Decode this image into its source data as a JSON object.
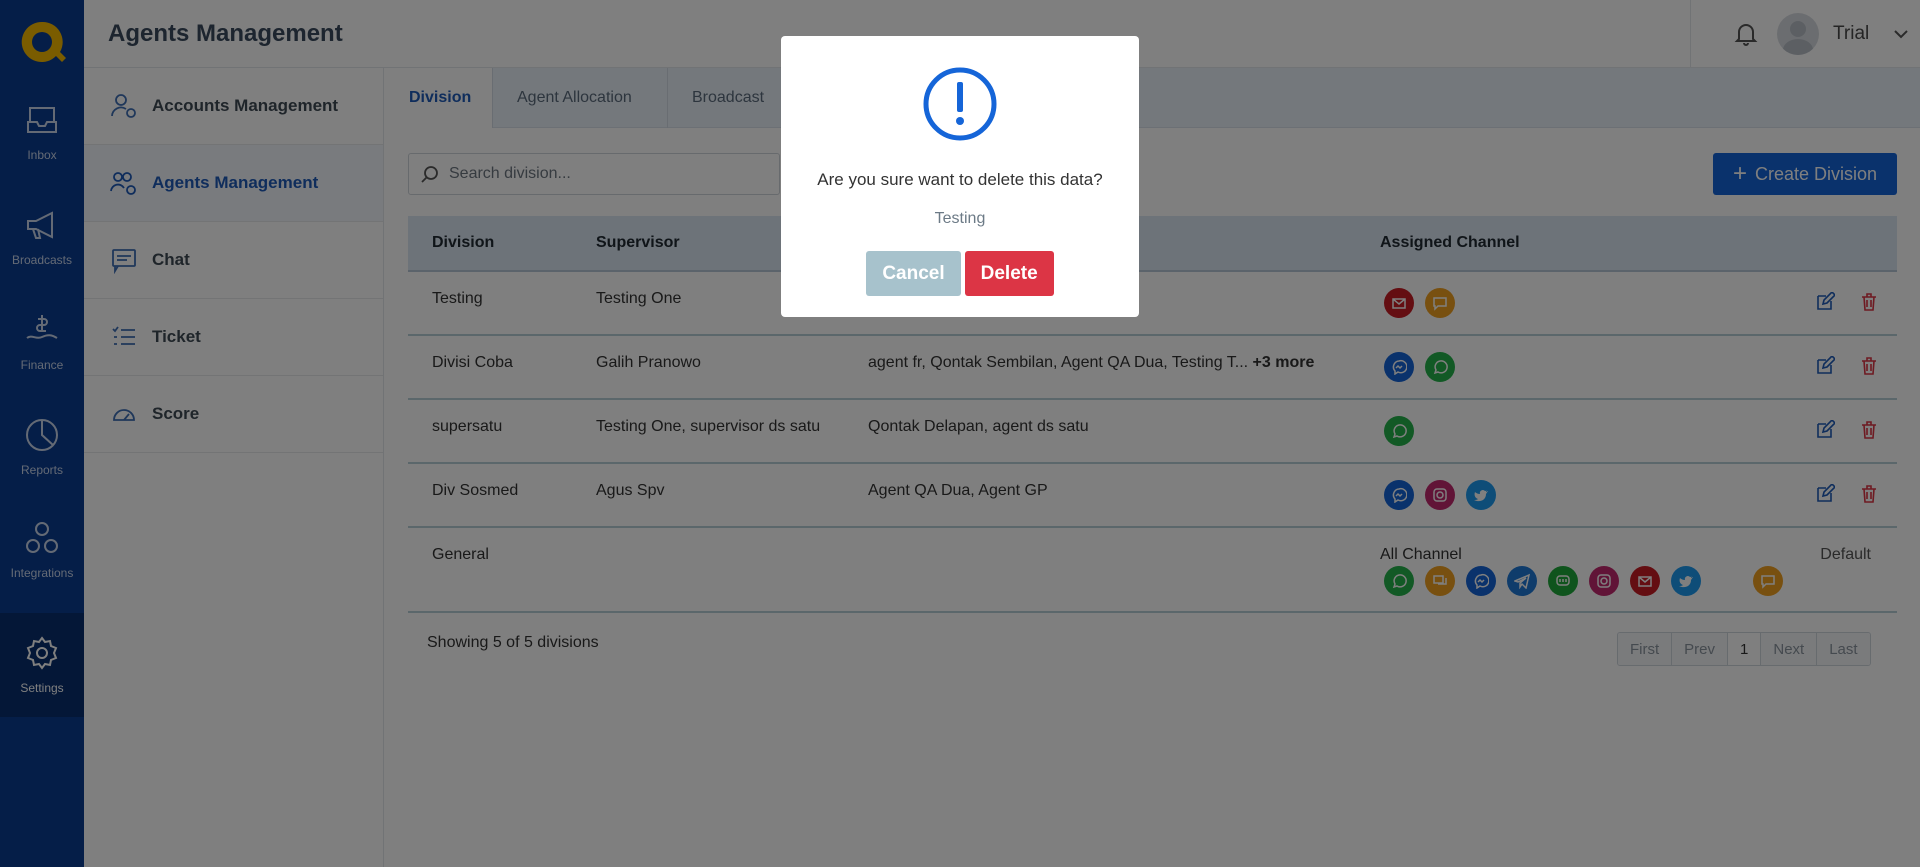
{
  "header": {
    "title": "Agents Management",
    "user_name": "Trial"
  },
  "rail": [
    {
      "label": "Inbox",
      "icon": "inbox-icon"
    },
    {
      "label": "Broadcasts",
      "icon": "megaphone-icon"
    },
    {
      "label": "Finance",
      "icon": "finance-icon"
    },
    {
      "label": "Reports",
      "icon": "pie-chart-icon"
    },
    {
      "label": "Integrations",
      "icon": "integrations-icon"
    },
    {
      "label": "Settings",
      "icon": "gear-icon"
    }
  ],
  "subnav": [
    {
      "label": "Accounts Management"
    },
    {
      "label": "Agents Management"
    },
    {
      "label": "Chat"
    },
    {
      "label": "Ticket"
    },
    {
      "label": "Score"
    }
  ],
  "tabs": [
    "Division",
    "Agent Allocation",
    "Broadcast"
  ],
  "search": {
    "placeholder": "Search division..."
  },
  "create_button": "Create Division",
  "table": {
    "headers": [
      "Division",
      "Supervisor",
      "",
      "Assigned Channel"
    ],
    "rows": [
      {
        "division": "Testing",
        "supervisor": "Testing One",
        "agents": "",
        "more": "",
        "channels": [
          "email",
          "chat"
        ]
      },
      {
        "division": "Divisi Coba",
        "supervisor": "Galih Pranowo",
        "agents": "agent fr, Qontak Sembilan, Agent QA Dua, Testing T...",
        "more": "+3 more",
        "channels": [
          "messenger",
          "whatsapp"
        ]
      },
      {
        "division": "supersatu",
        "supervisor": "Testing One, supervisor ds satu",
        "agents": "Qontak Delapan, agent ds satu",
        "more": "",
        "channels": [
          "whatsapp"
        ]
      },
      {
        "division": "Div Sosmed",
        "supervisor": "Agus Spv",
        "agents": "Agent QA Dua, Agent GP",
        "more": "",
        "channels": [
          "messenger",
          "instagram",
          "twitter"
        ]
      }
    ],
    "general": {
      "division": "General",
      "all_channel": "All Channel",
      "default": "Default"
    }
  },
  "footer": {
    "showing": "Showing 5 of 5 divisions"
  },
  "pager": {
    "first": "First",
    "prev": "Prev",
    "page": "1",
    "next": "Next",
    "last": "Last"
  },
  "modal": {
    "question": "Are you sure want to delete this data?",
    "item_name": "Testing",
    "cancel": "Cancel",
    "delete": "Delete"
  },
  "colors": {
    "rail": "#0b3d91",
    "primary": "#1565d8",
    "danger": "#dc3545",
    "cancel": "#a7c2cc",
    "logo": "#f5b800"
  }
}
